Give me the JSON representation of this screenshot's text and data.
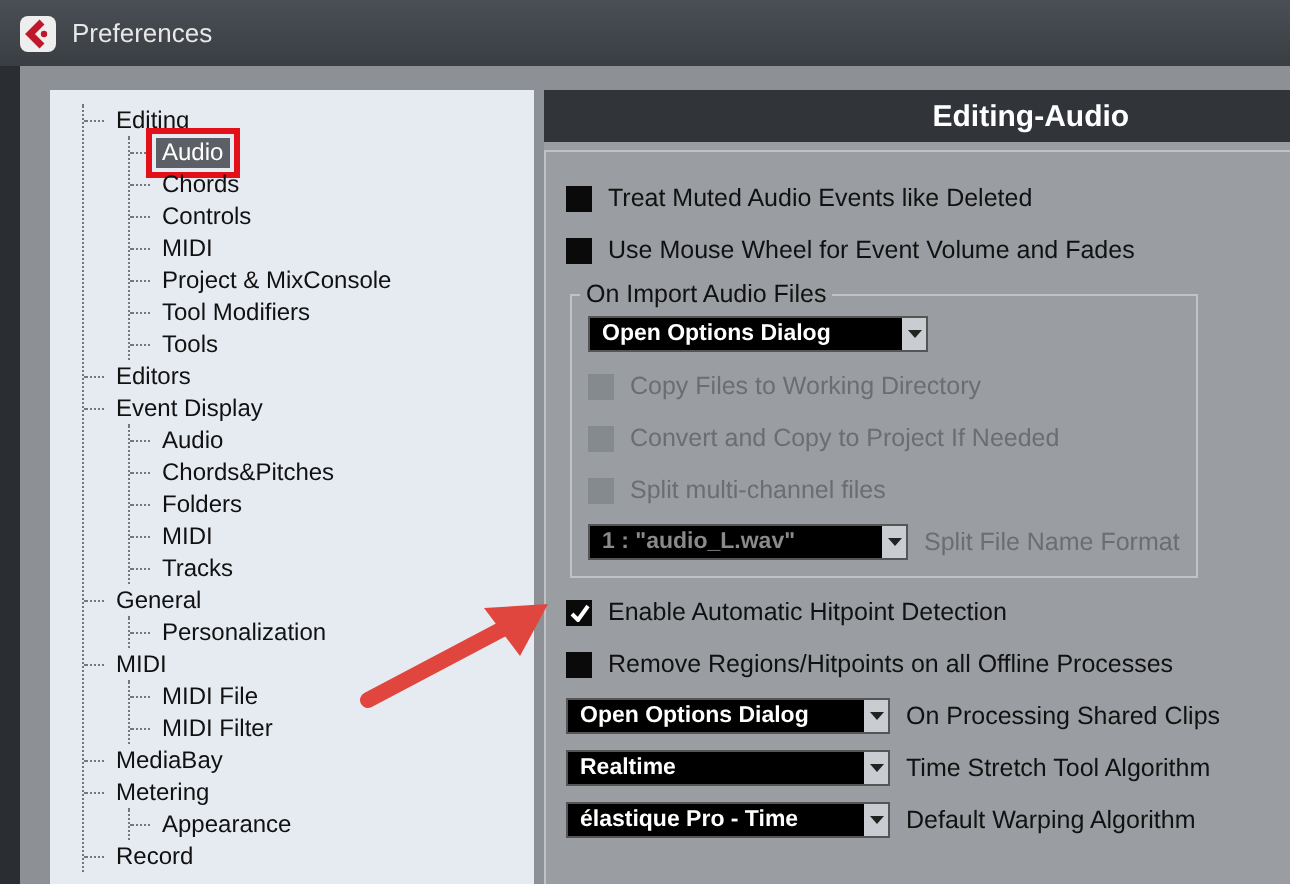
{
  "window": {
    "title": "Preferences"
  },
  "annotation_arrow": true,
  "tree": [
    {
      "label": "Editing",
      "selected": false,
      "highlighted": false,
      "children": [
        {
          "label": "Audio",
          "selected": true,
          "highlighted": true
        },
        {
          "label": "Chords",
          "selected": false,
          "highlighted": false
        },
        {
          "label": "Controls",
          "selected": false,
          "highlighted": false
        },
        {
          "label": "MIDI",
          "selected": false,
          "highlighted": false
        },
        {
          "label": "Project & MixConsole",
          "selected": false,
          "highlighted": false
        },
        {
          "label": "Tool Modifiers",
          "selected": false,
          "highlighted": false
        },
        {
          "label": "Tools",
          "selected": false,
          "highlighted": false
        }
      ]
    },
    {
      "label": "Editors",
      "selected": false,
      "highlighted": false
    },
    {
      "label": "Event Display",
      "selected": false,
      "highlighted": false,
      "children": [
        {
          "label": "Audio",
          "selected": false,
          "highlighted": false
        },
        {
          "label": "Chords&Pitches",
          "selected": false,
          "highlighted": false
        },
        {
          "label": "Folders",
          "selected": false,
          "highlighted": false
        },
        {
          "label": "MIDI",
          "selected": false,
          "highlighted": false
        },
        {
          "label": "Tracks",
          "selected": false,
          "highlighted": false
        }
      ]
    },
    {
      "label": "General",
      "selected": false,
      "highlighted": false,
      "children": [
        {
          "label": "Personalization",
          "selected": false,
          "highlighted": false
        }
      ]
    },
    {
      "label": "MIDI",
      "selected": false,
      "highlighted": false,
      "children": [
        {
          "label": "MIDI File",
          "selected": false,
          "highlighted": false
        },
        {
          "label": "MIDI Filter",
          "selected": false,
          "highlighted": false
        }
      ]
    },
    {
      "label": "MediaBay",
      "selected": false,
      "highlighted": false
    },
    {
      "label": "Metering",
      "selected": false,
      "highlighted": false,
      "children": [
        {
          "label": "Appearance",
          "selected": false,
          "highlighted": false
        }
      ]
    },
    {
      "label": "Record",
      "selected": false,
      "highlighted": false
    }
  ],
  "panel": {
    "title": "Editing-Audio",
    "options": [
      {
        "kind": "checkbox",
        "label": "Treat Muted Audio Events like Deleted",
        "checked": false,
        "disabled": false
      },
      {
        "kind": "checkbox",
        "label": "Use Mouse Wheel for Event Volume and Fades",
        "checked": false,
        "disabled": false
      },
      {
        "kind": "group",
        "title": "On Import Audio Files",
        "items": [
          {
            "kind": "dropdown",
            "value": "Open Options Dialog",
            "disabled": false
          },
          {
            "kind": "checkbox",
            "label": "Copy Files to Working Directory",
            "checked": false,
            "disabled": true
          },
          {
            "kind": "checkbox",
            "label": "Convert and Copy to Project If Needed",
            "checked": false,
            "disabled": true
          },
          {
            "kind": "checkbox",
            "label": "Split multi-channel files",
            "checked": false,
            "disabled": true
          },
          {
            "kind": "dropdown",
            "value": "1 : \"audio_L.wav\"",
            "caption": "Split File Name Format",
            "disabled": true
          }
        ]
      },
      {
        "kind": "checkbox",
        "label": "Enable Automatic Hitpoint Detection",
        "checked": true,
        "disabled": false
      },
      {
        "kind": "checkbox",
        "label": "Remove Regions/Hitpoints on all Offline Processes",
        "checked": false,
        "disabled": false
      },
      {
        "kind": "dropdown",
        "value": "Open Options Dialog",
        "caption": "On Processing Shared Clips",
        "disabled": false
      },
      {
        "kind": "dropdown",
        "value": "Realtime",
        "caption": "Time Stretch Tool Algorithm",
        "disabled": false
      },
      {
        "kind": "dropdown",
        "value": "élastique Pro - Time",
        "caption": "Default Warping Algorithm",
        "disabled": false
      }
    ]
  }
}
